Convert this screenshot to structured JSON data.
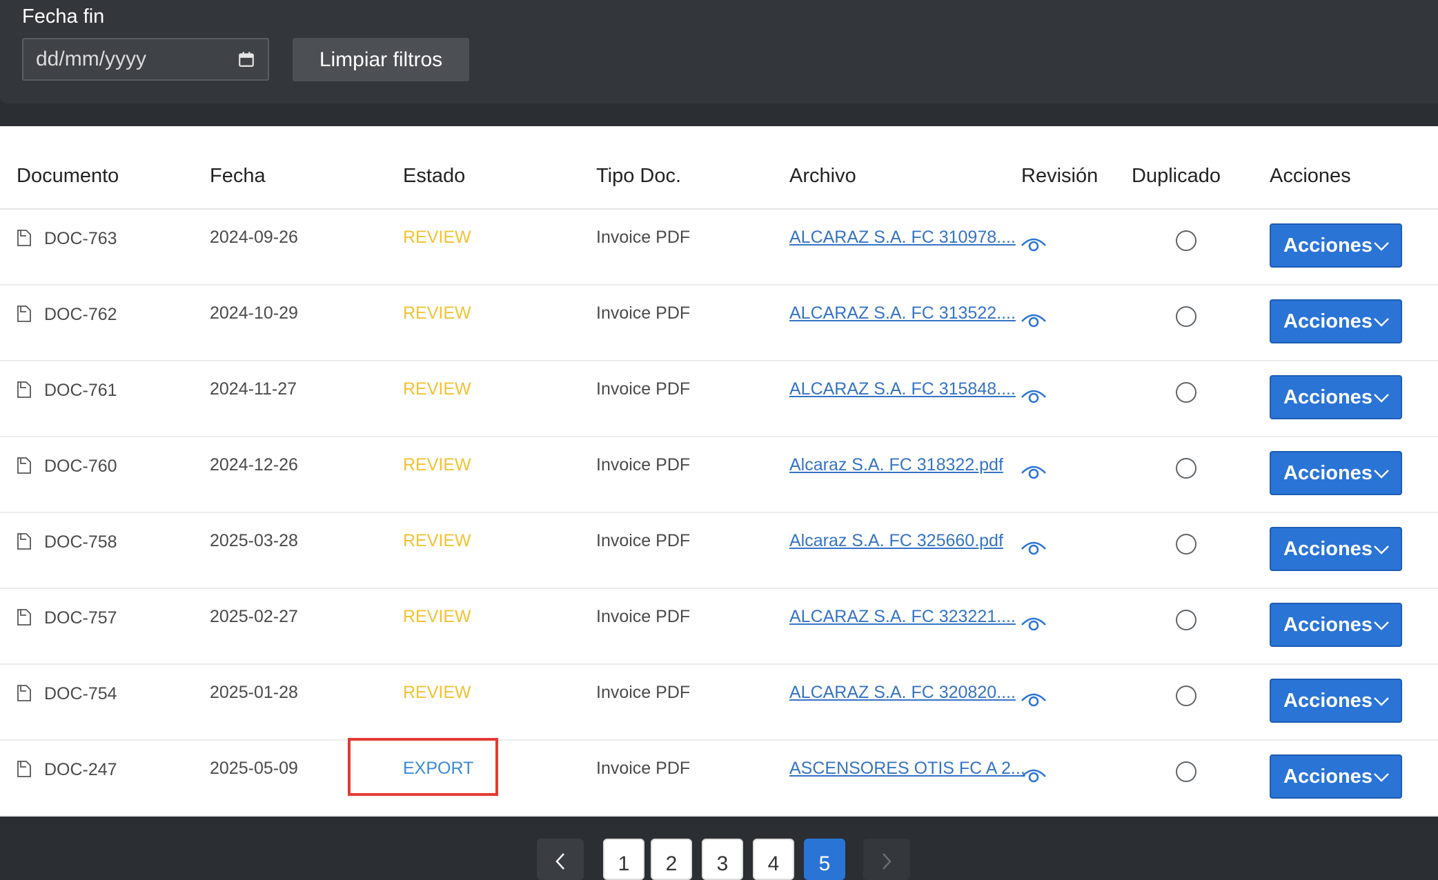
{
  "filters": {
    "end_date_label": "Fecha fin",
    "end_date_placeholder": "dd/mm/yyyy",
    "clear_button_label": "Limpiar filtros"
  },
  "table": {
    "columns": [
      "Documento",
      "Fecha",
      "Estado",
      "Tipo Doc.",
      "Archivo",
      "Revisión",
      "Duplicado",
      "Acciones"
    ],
    "actions_label": "Acciones",
    "rows": [
      {
        "doc": "DOC-763",
        "date": "2024-09-26",
        "status": "REVIEW",
        "type": "Invoice PDF",
        "file": "ALCARAZ S.A. FC 310978...."
      },
      {
        "doc": "DOC-762",
        "date": "2024-10-29",
        "status": "REVIEW",
        "type": "Invoice PDF",
        "file": "ALCARAZ S.A. FC 313522...."
      },
      {
        "doc": "DOC-761",
        "date": "2024-11-27",
        "status": "REVIEW",
        "type": "Invoice PDF",
        "file": "ALCARAZ S.A. FC 315848...."
      },
      {
        "doc": "DOC-760",
        "date": "2024-12-26",
        "status": "REVIEW",
        "type": "Invoice PDF",
        "file": "Alcaraz S.A. FC 318322.pdf"
      },
      {
        "doc": "DOC-758",
        "date": "2025-03-28",
        "status": "REVIEW",
        "type": "Invoice PDF",
        "file": "Alcaraz S.A. FC 325660.pdf"
      },
      {
        "doc": "DOC-757",
        "date": "2025-02-27",
        "status": "REVIEW",
        "type": "Invoice PDF",
        "file": "ALCARAZ S.A. FC 323221...."
      },
      {
        "doc": "DOC-754",
        "date": "2025-01-28",
        "status": "REVIEW",
        "type": "Invoice PDF",
        "file": "ALCARAZ S.A. FC 320820...."
      },
      {
        "doc": "DOC-247",
        "date": "2025-05-09",
        "status": "EXPORT",
        "type": "Invoice PDF",
        "file": "ASCENSORES OTIS FC A 2..."
      }
    ]
  },
  "pagination": {
    "pages": [
      "1",
      "2",
      "3",
      "4",
      "5"
    ],
    "current_page": "5"
  },
  "colors": {
    "review": "#f1c232",
    "export": "#3b8ad8",
    "primary": "#2a74d6",
    "highlight": "#e53935"
  },
  "icons": {
    "calendar": "calendar-icon",
    "document": "document-icon",
    "review": "eye-icon",
    "dropdown": "chevron-down-icon",
    "prev": "chevron-left-icon",
    "next": "chevron-right-icon"
  }
}
